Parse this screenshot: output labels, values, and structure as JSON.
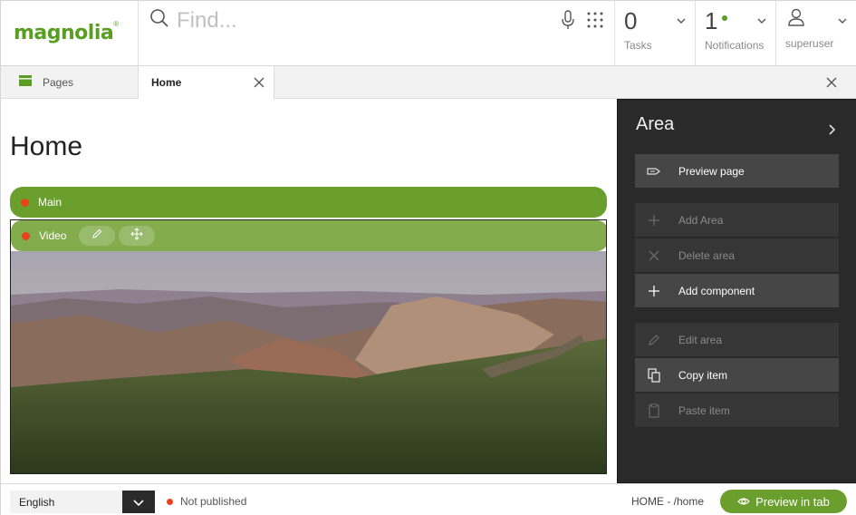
{
  "header": {
    "logo_text": "magnolia",
    "logo_mark": "®",
    "search_placeholder": "Find...",
    "tasks": {
      "count": "0",
      "label": "Tasks"
    },
    "notifications": {
      "count": "1",
      "label": "Notifications"
    },
    "user": {
      "label": "superuser"
    }
  },
  "tabs": {
    "pages_label": "Pages",
    "home_label": "Home"
  },
  "page": {
    "title": "Home",
    "main_bar_label": "Main",
    "video_bar_label": "Video"
  },
  "area_panel": {
    "title": "Area",
    "actions": [
      {
        "label": "Preview page",
        "enabled": true
      },
      {
        "label": "Add Area",
        "enabled": false
      },
      {
        "label": "Delete area",
        "enabled": false
      },
      {
        "label": "Add component",
        "enabled": true
      },
      {
        "label": "Edit area",
        "enabled": false
      },
      {
        "label": "Copy item",
        "enabled": true
      },
      {
        "label": "Paste item",
        "enabled": false
      }
    ]
  },
  "footer": {
    "language": "English",
    "publish_status": "Not published",
    "path": "HOME - /home",
    "preview_button": "Preview in tab"
  },
  "colors": {
    "brand_green": "#599e21",
    "bar_green": "#6a9f2e",
    "status_red": "#e8431d",
    "panel_dark": "#2a2a2a"
  }
}
